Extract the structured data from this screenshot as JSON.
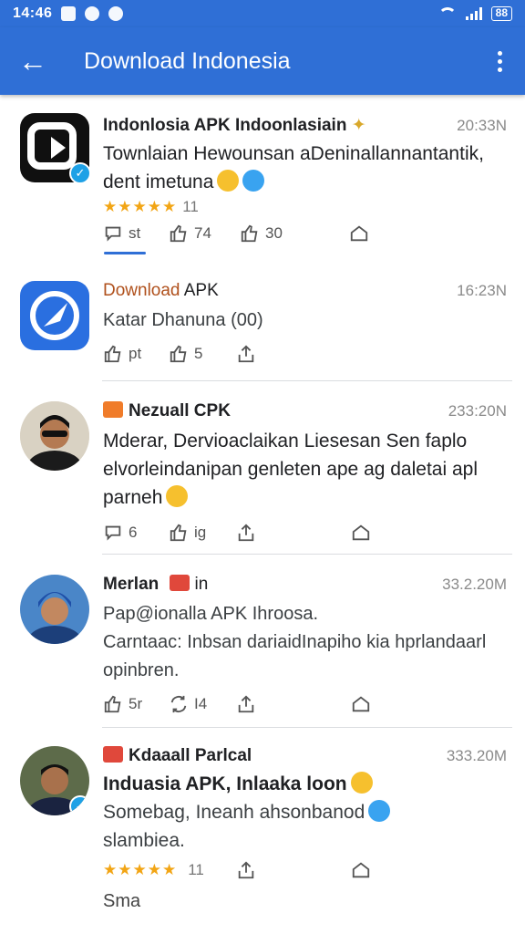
{
  "status_bar": {
    "time": "14:46",
    "battery": "88"
  },
  "app_bar": {
    "title": "Download Indonesia"
  },
  "items": [
    {
      "name": "Indonlosia APK Indoonlasiain",
      "time": "20:33N",
      "text_line1": "Townlaian Hewounsan aDeninallannantantik,",
      "text_line2": "dent imetuna",
      "rating_count": "11",
      "likes": "st",
      "shares": "74",
      "thumbs": "30"
    },
    {
      "name_brand": "Download",
      "name_rest": "APK",
      "time": "16:23N",
      "text_line1": "Katar Dhanuna (00)",
      "likes": "pt",
      "shares": "5"
    },
    {
      "name": "Nezuall CPK",
      "time": "233:20N",
      "text_line1": "Mderar, Dervioaclaikan Liesesan Sen faplo",
      "text_line2": "elvorleindanipan genleten ape ag daletai apl",
      "text_line3": "parneh",
      "likes": "6",
      "shares": "ig"
    },
    {
      "name": "Merlan",
      "name_suffix": "in",
      "time": "33.2.20M",
      "text_line1": "Pap@ionalla APK Ihroosa.",
      "text_line2": "Carntaac: Inbsan dariaidInapiho kia hprlandaarl",
      "text_line3": "opinbren.",
      "likes": "5r",
      "shares": "I4"
    },
    {
      "name": "Kdaaall Parlcal",
      "time": "333.20M",
      "text_line1": "Induasia APK, Inlaaka loon",
      "text_line2": "Somebag, Ineanh ahsonbanod",
      "text_line3": "slambiea.",
      "rating_count": "11",
      "footer": "Sma"
    }
  ],
  "icons": {
    "back": "arrow-left-icon",
    "more": "more-vert-icon",
    "reply": "reply-icon",
    "like": "thumbs-up-icon",
    "share": "share-icon",
    "save": "save-icon"
  },
  "colors": {
    "accent": "#2f6fd6",
    "star": "#f2a515",
    "verified": "#1ea1e6"
  }
}
